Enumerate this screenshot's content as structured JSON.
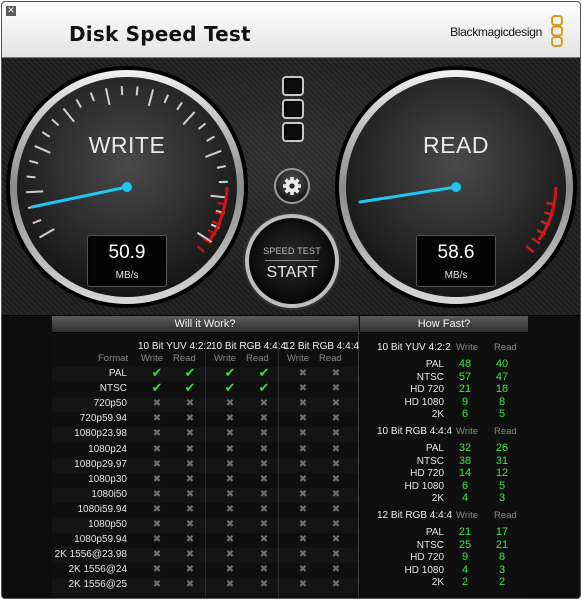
{
  "app": {
    "title": "Disk Speed Test",
    "brand": "Blackmagicdesign",
    "close_glyph": "✕"
  },
  "gauges": {
    "write": {
      "label": "WRITE",
      "value": "50.9",
      "unit": "MB/s"
    },
    "read": {
      "label": "READ",
      "value": "58.6",
      "unit": "MB/s"
    }
  },
  "controls": {
    "speed_test_label": "SPEED TEST",
    "start_label": "START",
    "settings_icon": "gear-icon"
  },
  "will_it_work": {
    "title": "Will it Work?",
    "format_label": "Format",
    "groups": [
      {
        "name": "10 Bit YUV 4:2:2",
        "cols": [
          "Write",
          "Read"
        ]
      },
      {
        "name": "10 Bit RGB 4:4:4",
        "cols": [
          "Write",
          "Read"
        ]
      },
      {
        "name": "12 Bit RGB 4:4:4",
        "cols": [
          "Write",
          "Read"
        ]
      }
    ],
    "rows": [
      {
        "format": "PAL",
        "marks": [
          1,
          1,
          1,
          1,
          0,
          0
        ]
      },
      {
        "format": "NTSC",
        "marks": [
          1,
          1,
          1,
          1,
          0,
          0
        ]
      },
      {
        "format": "720p50",
        "marks": [
          0,
          0,
          0,
          0,
          0,
          0
        ]
      },
      {
        "format": "720p59.94",
        "marks": [
          0,
          0,
          0,
          0,
          0,
          0
        ]
      },
      {
        "format": "1080p23.98",
        "marks": [
          0,
          0,
          0,
          0,
          0,
          0
        ]
      },
      {
        "format": "1080p24",
        "marks": [
          0,
          0,
          0,
          0,
          0,
          0
        ]
      },
      {
        "format": "1080p29.97",
        "marks": [
          0,
          0,
          0,
          0,
          0,
          0
        ]
      },
      {
        "format": "1080p30",
        "marks": [
          0,
          0,
          0,
          0,
          0,
          0
        ]
      },
      {
        "format": "1080i50",
        "marks": [
          0,
          0,
          0,
          0,
          0,
          0
        ]
      },
      {
        "format": "1080i59.94",
        "marks": [
          0,
          0,
          0,
          0,
          0,
          0
        ]
      },
      {
        "format": "1080p50",
        "marks": [
          0,
          0,
          0,
          0,
          0,
          0
        ]
      },
      {
        "format": "1080p59.94",
        "marks": [
          0,
          0,
          0,
          0,
          0,
          0
        ]
      },
      {
        "format": "2K 1556@23.98",
        "marks": [
          0,
          0,
          0,
          0,
          0,
          0
        ]
      },
      {
        "format": "2K 1556@24",
        "marks": [
          0,
          0,
          0,
          0,
          0,
          0
        ]
      },
      {
        "format": "2K 1556@25",
        "marks": [
          0,
          0,
          0,
          0,
          0,
          0
        ]
      }
    ]
  },
  "how_fast": {
    "title": "How Fast?",
    "sections": [
      {
        "name": "10 Bit YUV 4:2:2",
        "cols": [
          "Write",
          "Read"
        ],
        "rows": [
          {
            "label": "PAL",
            "write": "48",
            "read": "40"
          },
          {
            "label": "NTSC",
            "write": "57",
            "read": "47"
          },
          {
            "label": "HD 720",
            "write": "21",
            "read": "18"
          },
          {
            "label": "HD 1080",
            "write": "9",
            "read": "8"
          },
          {
            "label": "2K",
            "write": "6",
            "read": "5"
          }
        ]
      },
      {
        "name": "10 Bit RGB 4:4:4",
        "cols": [
          "Write",
          "Read"
        ],
        "rows": [
          {
            "label": "PAL",
            "write": "32",
            "read": "26"
          },
          {
            "label": "NTSC",
            "write": "38",
            "read": "31"
          },
          {
            "label": "HD 720",
            "write": "14",
            "read": "12"
          },
          {
            "label": "HD 1080",
            "write": "6",
            "read": "5"
          },
          {
            "label": "2K",
            "write": "4",
            "read": "3"
          }
        ]
      },
      {
        "name": "12 Bit RGB 4:4:4",
        "cols": [
          "Write",
          "Read"
        ],
        "rows": [
          {
            "label": "PAL",
            "write": "21",
            "read": "17"
          },
          {
            "label": "NTSC",
            "write": "25",
            "read": "21"
          },
          {
            "label": "HD 720",
            "write": "9",
            "read": "8"
          },
          {
            "label": "HD 1080",
            "write": "4",
            "read": "3"
          },
          {
            "label": "2K",
            "write": "2",
            "read": "2"
          }
        ]
      }
    ]
  },
  "colors": {
    "needle": "#1fc6ef",
    "redline": "#d41414",
    "ok_green": "#3ddc3d",
    "value_green": "#3de83d"
  }
}
